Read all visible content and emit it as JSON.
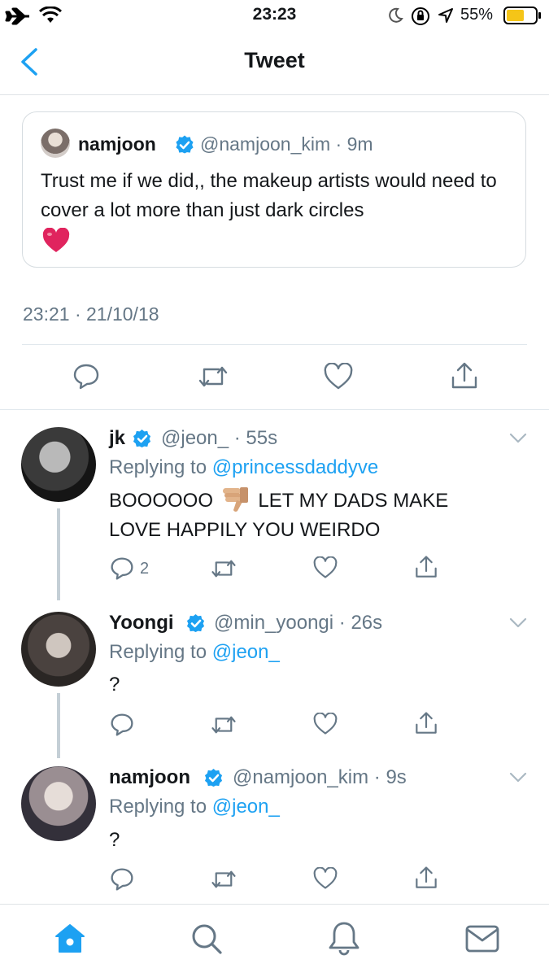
{
  "status": {
    "time": "23:23",
    "battery_pct": "55%"
  },
  "nav": {
    "title": "Tweet"
  },
  "quoted": {
    "name": "namjoon",
    "handle": "@namjoon_kim",
    "time": "9m",
    "text": "Trust me if we did,, the makeup artists would need to cover a lot more than just dark circles",
    "emoji": "heart"
  },
  "timestamp": "23:21 · 21/10/18",
  "replies": [
    {
      "name": "jk",
      "handle": "@jeon_",
      "time": "55s",
      "reply_prefix": "Replying to",
      "reply_to": "@princessdaddyve",
      "text_before": "BOOOOOO",
      "text_after": "LET MY DADS MAKE",
      "text_line2": "LOVE HAPPILY YOU WEIRDO",
      "reply_count": "2"
    },
    {
      "name": "Yoongi",
      "handle": "@min_yoongi",
      "time": "26s",
      "reply_prefix": "Replying to",
      "reply_to": "@jeon_",
      "text": "?"
    },
    {
      "name": "namjoon",
      "handle": "@namjoon_kim",
      "time": "9s",
      "reply_prefix": "Replying to",
      "reply_to": "@jeon_",
      "text": "?"
    }
  ],
  "colors": {
    "accent": "#1da1f2",
    "muted": "#657786",
    "verified": "#1da1f2",
    "heart": "#e0245e"
  }
}
